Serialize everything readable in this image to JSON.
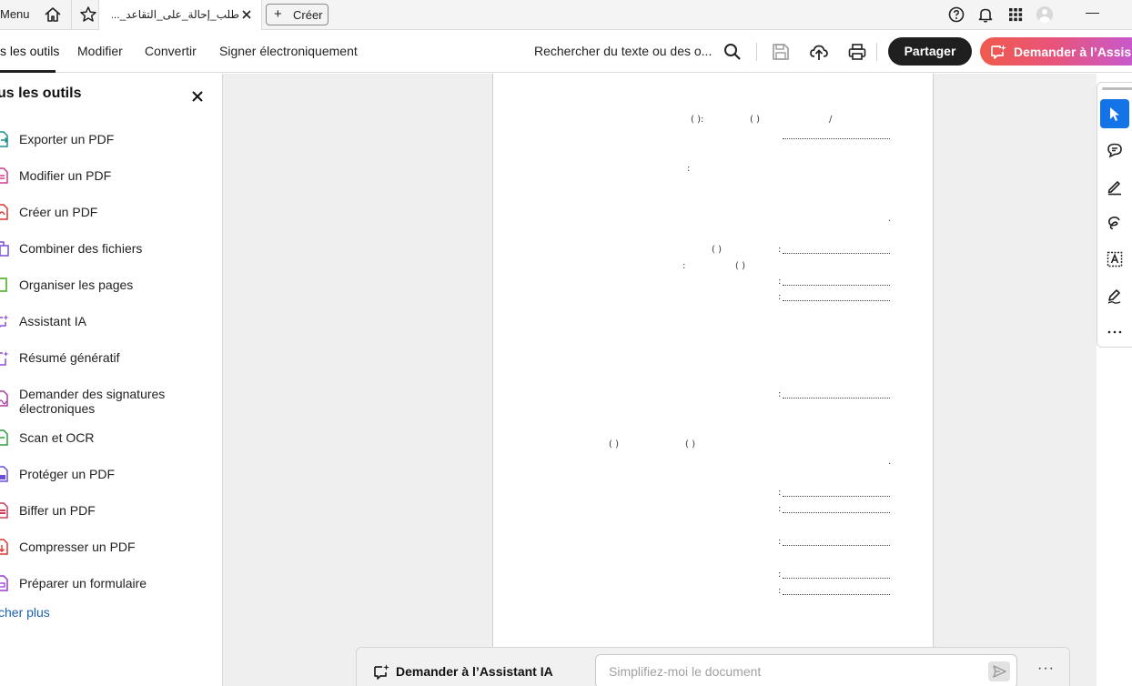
{
  "titlebar": {
    "menu_label": "Menu",
    "tab_title": "طلب_إحالة_على_التقاعد_...",
    "create_label": "Créer"
  },
  "toolbar": {
    "tabs": [
      {
        "label": "s les outils"
      },
      {
        "label": "Modifier"
      },
      {
        "label": "Convertir"
      },
      {
        "label": "Signer électroniquement"
      }
    ],
    "search_text": "Rechercher du texte ou des o...",
    "share_label": "Partager",
    "ai_button_label": "Demander à l’Assis"
  },
  "sidebar": {
    "title": "us les outils",
    "items": [
      {
        "label": "Exporter un PDF",
        "color": "#1a8f8a"
      },
      {
        "label": "Modifier un PDF",
        "color": "#d23c8c"
      },
      {
        "label": "Créer un PDF",
        "color": "#e0332d"
      },
      {
        "label": "Combiner des fichiers",
        "color": "#7b4ddb"
      },
      {
        "label": "Organiser les pages",
        "color": "#4caf2a"
      },
      {
        "label": "Assistant IA",
        "color": "#8c4ddb"
      },
      {
        "label": "Résumé génératif",
        "color": "#8c4ddb"
      },
      {
        "label": "Demander des signatures électroniques",
        "color": "#b03aa8"
      },
      {
        "label": "Scan et OCR",
        "color": "#2e9e3e"
      },
      {
        "label": "Protéger un PDF",
        "color": "#6b4ddb"
      },
      {
        "label": "Biffer un PDF",
        "color": "#d23c5a"
      },
      {
        "label": "Compresser un PDF",
        "color": "#e0332d"
      },
      {
        "label": "Préparer un formulaire",
        "color": "#9b3ad8"
      }
    ],
    "more_label": "cher plus"
  },
  "document": {
    "marks": [
      "(   ):",
      "(   )",
      "/",
      ":",
      ".",
      "(   )",
      ":",
      ":",
      "(   )",
      ":",
      ":",
      ":",
      "(   )",
      "(   )",
      ".",
      ":",
      ":",
      ":",
      ":",
      ":"
    ]
  },
  "aibar": {
    "label": "Demander à l’Assistant IA",
    "placeholder": "Simplifiez-moi le document",
    "more": "···"
  },
  "colors": {
    "accent_blue": "#1473e6",
    "share_bg": "#1f1f1f",
    "ai_gradient_start": "#f05a4c",
    "ai_gradient_end": "#c25ad8"
  }
}
